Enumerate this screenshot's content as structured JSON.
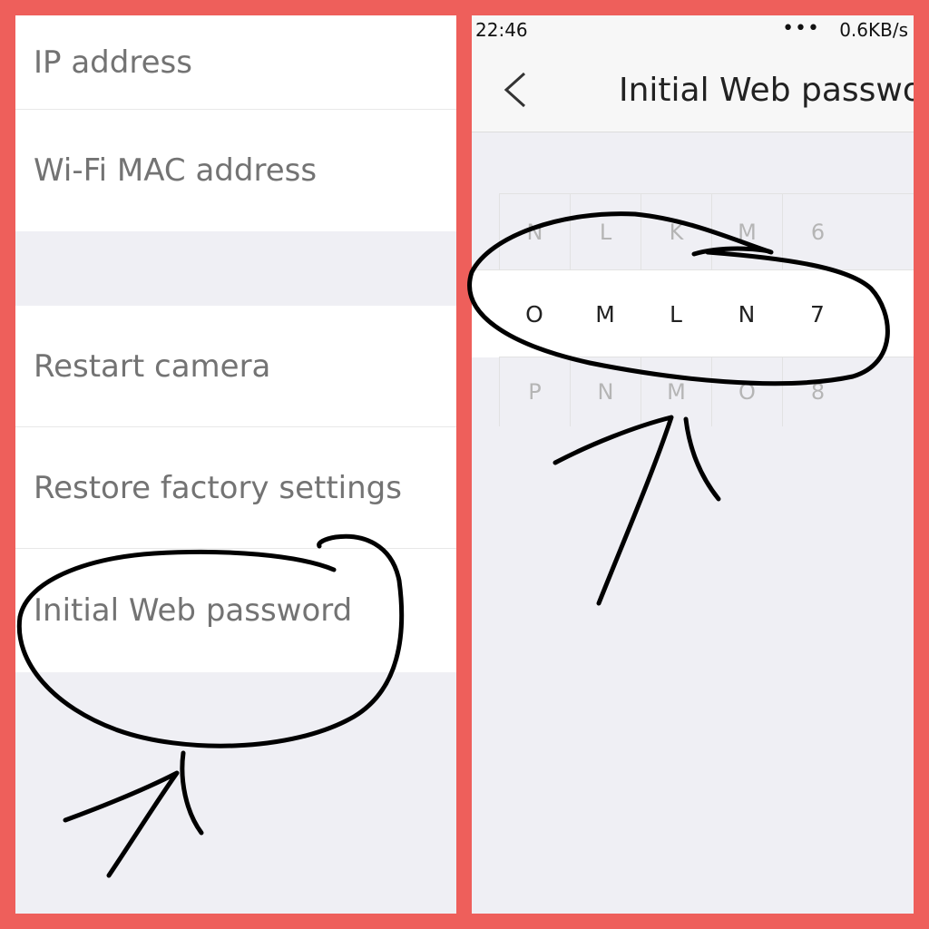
{
  "left_panel": {
    "items": [
      {
        "label": "IP address"
      },
      {
        "label": "Wi-Fi MAC address"
      },
      {
        "label": "Restart camera"
      },
      {
        "label": "Restore factory settings"
      },
      {
        "label": "Initial Web password"
      }
    ]
  },
  "right_panel": {
    "status_bar": {
      "time": "22:46",
      "more": "•••",
      "speed": "0.6KB/s"
    },
    "nav": {
      "back_icon": "chevron-left-icon",
      "title": "Initial Web passwo"
    },
    "password_picker": {
      "rows": [
        [
          "N",
          "L",
          "K",
          "M",
          "6"
        ],
        [
          "O",
          "M",
          "L",
          "N",
          "7"
        ],
        [
          "P",
          "N",
          "M",
          "O",
          "8"
        ]
      ],
      "selected_row": 1
    }
  },
  "colors": {
    "frame": "#ee5f5b",
    "annotation": "#000000"
  }
}
